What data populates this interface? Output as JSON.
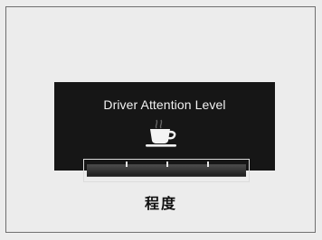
{
  "display": {
    "title": "Driver Attention Level",
    "icon": "coffee-cup-icon",
    "attention_level": 1.0,
    "segments": 4
  },
  "caption": "程度",
  "colors": {
    "panel": "#161616",
    "text": "#f2f2f2",
    "background": "#ececec"
  }
}
